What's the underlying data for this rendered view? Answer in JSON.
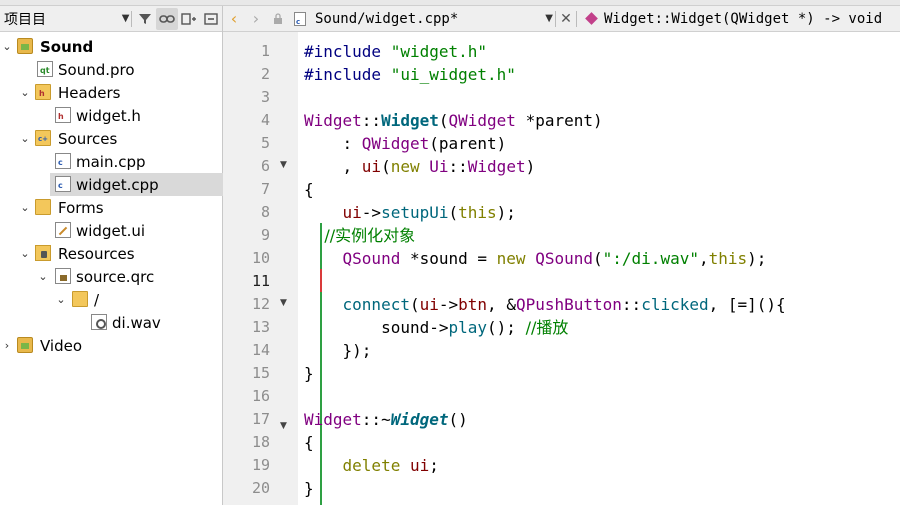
{
  "project_panel": {
    "selector_label": "项目目"
  },
  "tree": [
    {
      "label": "Sound",
      "icon": "project-icon",
      "bold": true,
      "expanded": true
    },
    {
      "label": "Sound.pro",
      "icon": "pro-file-icon"
    },
    {
      "label": "Headers",
      "icon": "headers-folder-icon",
      "expanded": true
    },
    {
      "label": "widget.h",
      "icon": "header-file-icon"
    },
    {
      "label": "Sources",
      "icon": "sources-folder-icon",
      "expanded": true
    },
    {
      "label": "main.cpp",
      "icon": "cpp-file-icon"
    },
    {
      "label": "widget.cpp",
      "icon": "cpp-file-icon",
      "selected": true
    },
    {
      "label": "Forms",
      "icon": "forms-folder-icon",
      "expanded": true
    },
    {
      "label": "widget.ui",
      "icon": "ui-file-icon"
    },
    {
      "label": "Resources",
      "icon": "resources-folder-icon",
      "expanded": true
    },
    {
      "label": "source.qrc",
      "icon": "qrc-file-icon",
      "expanded": true
    },
    {
      "label": "/",
      "icon": "folder-icon",
      "expanded": true
    },
    {
      "label": "di.wav",
      "icon": "wav-file-icon"
    },
    {
      "label": "Video",
      "icon": "project-icon",
      "bold": true,
      "expanded": false
    }
  ],
  "editor": {
    "file_label": "Sound/widget.cpp*",
    "symbol_label": "Widget::Widget(QWidget *) -> void",
    "current_line": 11
  },
  "code_lines": [
    "#include \"widget.h\"",
    "#include \"ui_widget.h\"",
    "",
    "Widget::Widget(QWidget *parent)",
    "    : QWidget(parent)",
    "    , ui(new Ui::Widget)",
    "{",
    "    ui->setupUi(this);",
    "    //实例化对象",
    "    QSound *sound = new QSound(\":/di.wav\",this);",
    "",
    "    connect(ui->btn, &QPushButton::clicked, [=](){",
    "        sound->play(); //播放",
    "    });",
    "}",
    "",
    "Widget::~Widget()",
    "{",
    "    delete ui;",
    "}"
  ],
  "line_numbers": [
    "1",
    "2",
    "3",
    "4",
    "5",
    "6",
    "7",
    "8",
    "9",
    "10",
    "11",
    "12",
    "13",
    "14",
    "15",
    "16",
    "17",
    "18",
    "19",
    "20"
  ]
}
